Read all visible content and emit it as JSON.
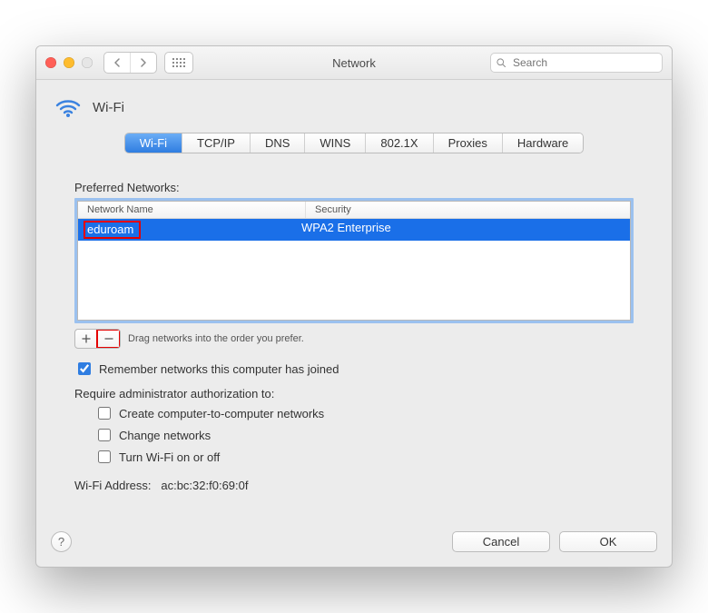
{
  "window": {
    "title": "Network",
    "search_placeholder": "Search"
  },
  "header": {
    "title": "Wi-Fi"
  },
  "tabs": [
    {
      "label": "Wi-Fi",
      "active": true
    },
    {
      "label": "TCP/IP",
      "active": false
    },
    {
      "label": "DNS",
      "active": false
    },
    {
      "label": "WINS",
      "active": false
    },
    {
      "label": "802.1X",
      "active": false
    },
    {
      "label": "Proxies",
      "active": false
    },
    {
      "label": "Hardware",
      "active": false
    }
  ],
  "preferred_networks": {
    "label": "Preferred Networks:",
    "columns": {
      "name": "Network Name",
      "security": "Security"
    },
    "rows": [
      {
        "name": "eduroam",
        "security": "WPA2 Enterprise",
        "selected": true,
        "highlighted": true
      }
    ],
    "hint": "Drag networks into the order you prefer."
  },
  "options": {
    "remember_label": "Remember networks this computer has joined",
    "remember_checked": true,
    "require_admin_label": "Require administrator authorization to:",
    "subs": [
      {
        "label": "Create computer-to-computer networks",
        "checked": false
      },
      {
        "label": "Change networks",
        "checked": false
      },
      {
        "label": "Turn Wi-Fi on or off",
        "checked": false
      }
    ]
  },
  "wifi_address": {
    "label": "Wi-Fi Address:",
    "value": "ac:bc:32:f0:69:0f"
  },
  "footer": {
    "cancel": "Cancel",
    "ok": "OK"
  }
}
